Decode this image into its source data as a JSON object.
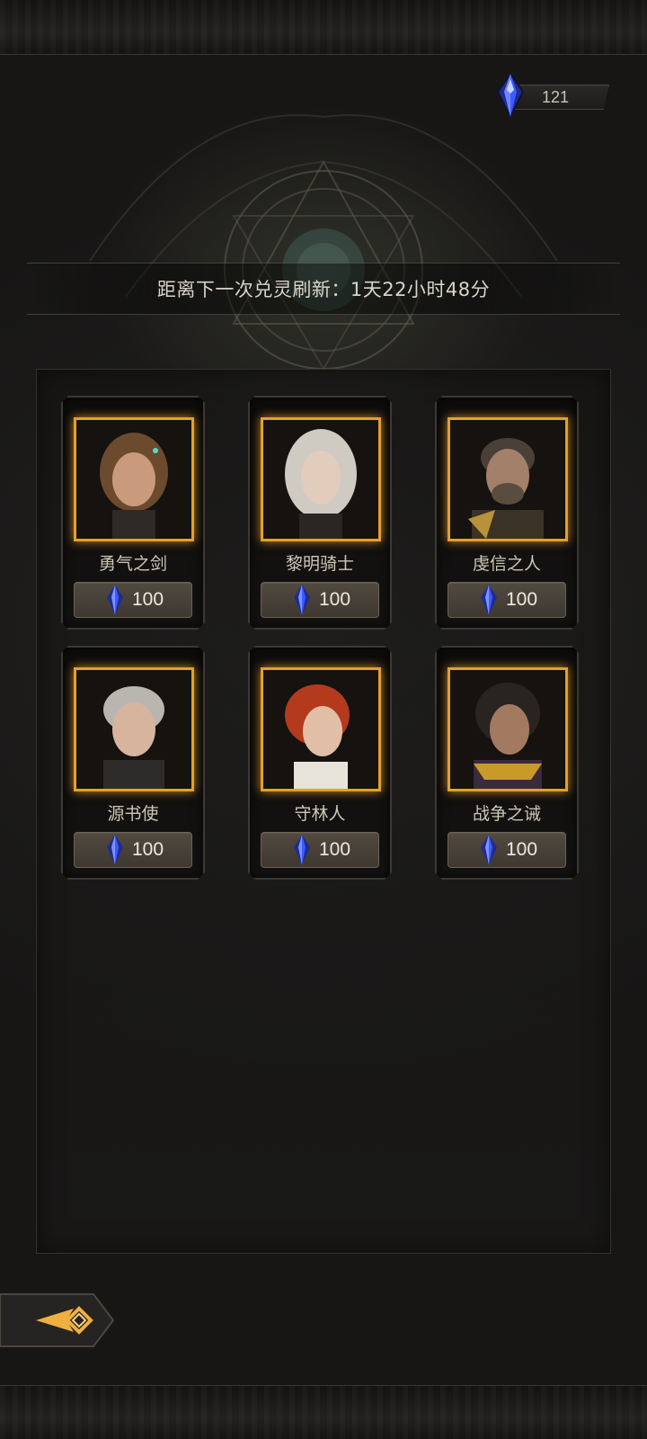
{
  "currency": {
    "icon": "blue-crystal-icon",
    "amount": "121",
    "color": "#3b5cff"
  },
  "refresh_banner": {
    "text": "距离下一次兑灵刷新：1天22小时48分"
  },
  "heroes": [
    {
      "name": "勇气之剑",
      "price": "100",
      "price_icon": "blue-crystal-icon",
      "portrait_hair": "#6b4a2e"
    },
    {
      "name": "黎明骑士",
      "price": "100",
      "price_icon": "blue-crystal-icon",
      "portrait_hair": "#cfcac2"
    },
    {
      "name": "虔信之人",
      "price": "100",
      "price_icon": "blue-crystal-icon",
      "portrait_hair": "#4a4038"
    },
    {
      "name": "源书使",
      "price": "100",
      "price_icon": "blue-crystal-icon",
      "portrait_hair": "#b9b6b0"
    },
    {
      "name": "守林人",
      "price": "100",
      "price_icon": "blue-crystal-icon",
      "portrait_hair": "#b33a1c"
    },
    {
      "name": "战争之诫",
      "price": "100",
      "price_icon": "blue-crystal-icon",
      "portrait_hair": "#2a2420"
    }
  ],
  "back_button": {
    "icon": "back-arrow-icon",
    "accent": "#f0b040"
  },
  "colors": {
    "frame_gold": "#e2a128",
    "background": "#1c1b1a"
  }
}
